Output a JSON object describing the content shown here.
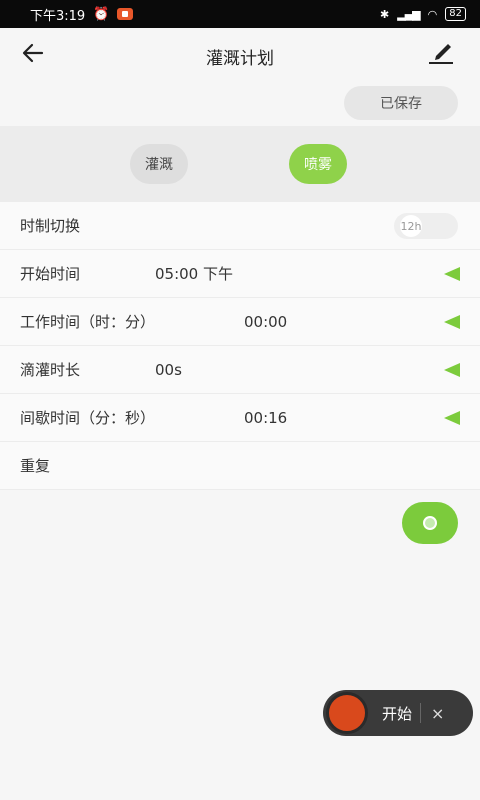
{
  "status_bar": {
    "time": "下午3:19",
    "battery": "82"
  },
  "header": {
    "title": "灌溉计划",
    "saved_label": "已保存"
  },
  "modes": {
    "irrigate_label": "灌溉",
    "spray_label": "喷雾",
    "selected": "喷雾"
  },
  "rows": {
    "time_format": {
      "label": "时制切换",
      "toggle_text": "12h"
    },
    "start_time": {
      "label": "开始时间",
      "value": "05:00 下午"
    },
    "work_time": {
      "label": "工作时间（时：分）",
      "value": "00:00"
    },
    "drip_duration": {
      "label": "滴灌时长",
      "value": "00s"
    },
    "interval_time": {
      "label": "间歇时间（分：秒）",
      "value": "00:16"
    },
    "repeat": {
      "label": "重复"
    }
  },
  "float_bar": {
    "start_label": "开始",
    "close_label": "×"
  },
  "colors": {
    "accent_green": "#7ccb3c",
    "record_orange": "#d9491c"
  }
}
